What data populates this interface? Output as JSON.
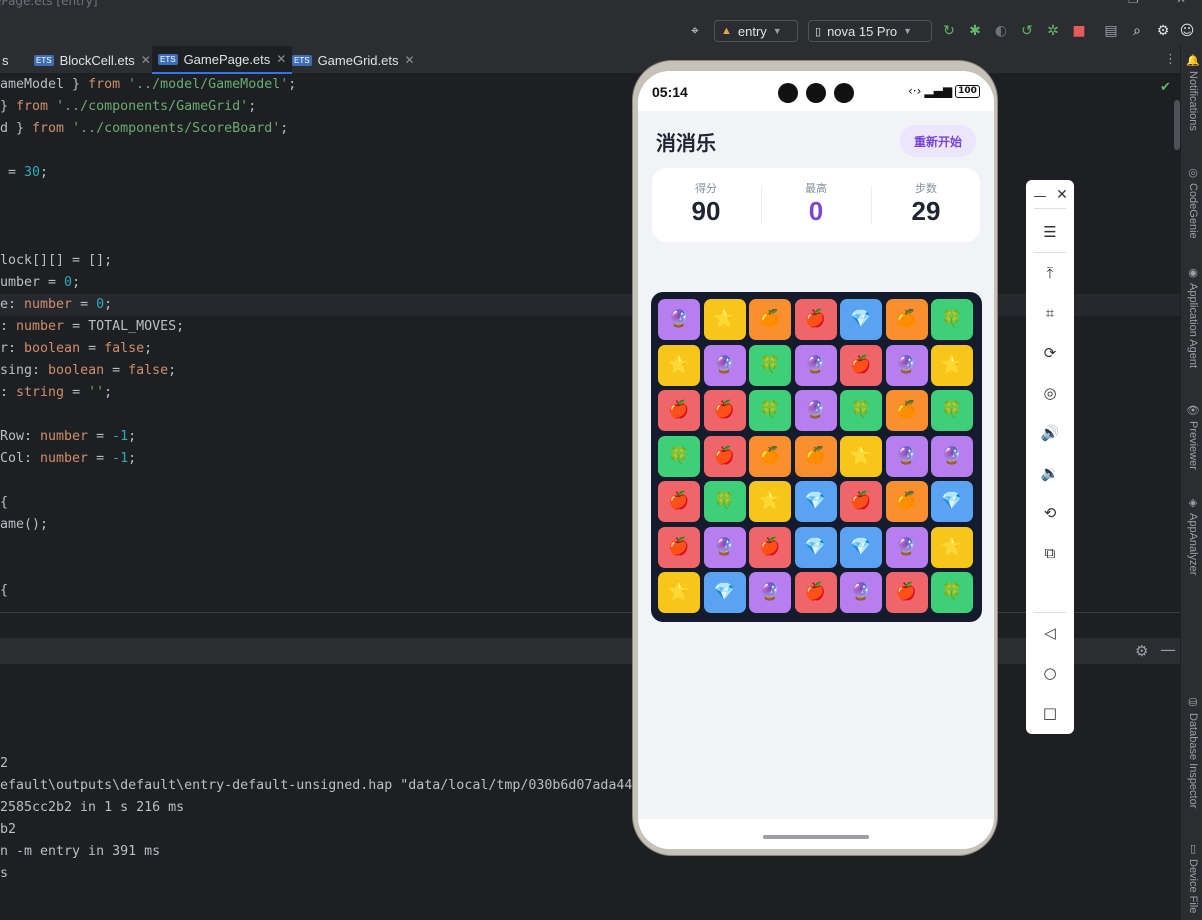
{
  "titlebar": {
    "text": "ePage.ets [entry]"
  },
  "toolbar": {
    "module": "entry",
    "device": "nova 15 Pro"
  },
  "tabs": [
    {
      "label": "s"
    },
    {
      "label": "BlockCell.ets"
    },
    {
      "label": "GamePage.ets"
    },
    {
      "label": "GameGrid.ets"
    }
  ],
  "editor": {
    "lines": [
      {
        "t": "ameModel } from '../model/GameModel';"
      },
      {
        "t": "} from '../components/GameGrid';"
      },
      {
        "t": "d } from '../components/ScoreBoard';"
      },
      {
        "t": ""
      },
      {
        "t": " = 30;"
      },
      {
        "t": ""
      },
      {
        "t": ""
      },
      {
        "t": ""
      },
      {
        "t": "lock[][] = [];"
      },
      {
        "t": "umber = 0;"
      },
      {
        "t": "e: number = 0;"
      },
      {
        "t": ": number = TOTAL_MOVES;"
      },
      {
        "t": "r: boolean = false;"
      },
      {
        "t": "sing: boolean = false;"
      },
      {
        "t": ": string = '';"
      },
      {
        "t": ""
      },
      {
        "t": "Row: number = -1;"
      },
      {
        "t": "Col: number = -1;"
      },
      {
        "t": ""
      },
      {
        "t": "{"
      },
      {
        "t": "ame();"
      },
      {
        "t": ""
      },
      {
        "t": ""
      },
      {
        "t": "{"
      }
    ]
  },
  "console": {
    "lines": [
      "2",
      "efault\\outputs\\default\\entry-default-unsigned.hap \"data/local/tmp/030b6d07ada44",
      "2585cc2b2 in 1 s 216 ms",
      "b2",
      "n -m entry in 391 ms",
      "s"
    ]
  },
  "rightbar": [
    "Notifications",
    "CodeGenie",
    "Application Agent",
    "Previewer",
    "AppAnalyzer",
    "Database Inspector",
    "Device File"
  ],
  "phone": {
    "time": "05:14",
    "battery": "100",
    "app": {
      "title": "消消乐",
      "restart": "重新开始",
      "score": {
        "label": "得分",
        "value": "90"
      },
      "best": {
        "label": "最高",
        "value": "0"
      },
      "moves": {
        "label": "步数",
        "value": "29"
      }
    },
    "grid": [
      [
        "purple",
        "yellow",
        "orange",
        "red",
        "blue",
        "orange",
        "green"
      ],
      [
        "yellow",
        "purple",
        "green",
        "purple",
        "red",
        "purple",
        "yellow"
      ],
      [
        "red",
        "red",
        "green",
        "purple",
        "green",
        "orange",
        "green"
      ],
      [
        "green",
        "red",
        "orange",
        "orange",
        "yellow",
        "purple",
        "purple"
      ],
      [
        "red",
        "green",
        "yellow",
        "blue",
        "red",
        "orange",
        "blue"
      ],
      [
        "red",
        "purple",
        "red",
        "blue",
        "blue",
        "purple",
        "yellow"
      ],
      [
        "yellow",
        "blue",
        "purple",
        "red",
        "purple",
        "red",
        "green"
      ]
    ],
    "tiles": {
      "purple": {
        "bg": "#b77ef0",
        "icon": "🔮"
      },
      "yellow": {
        "bg": "#f8c61b",
        "icon": "⭐"
      },
      "orange": {
        "bg": "#f98f2f",
        "icon": "🍊"
      },
      "red": {
        "bg": "#f0656a",
        "icon": "🍎"
      },
      "blue": {
        "bg": "#5aa3f2",
        "icon": "💎"
      },
      "green": {
        "bg": "#3ecf78",
        "icon": "🍀"
      }
    }
  },
  "colors": {
    "accent": "#7a46d6",
    "ide_bg": "#1e1f22",
    "board_bg": "#141b2c"
  }
}
